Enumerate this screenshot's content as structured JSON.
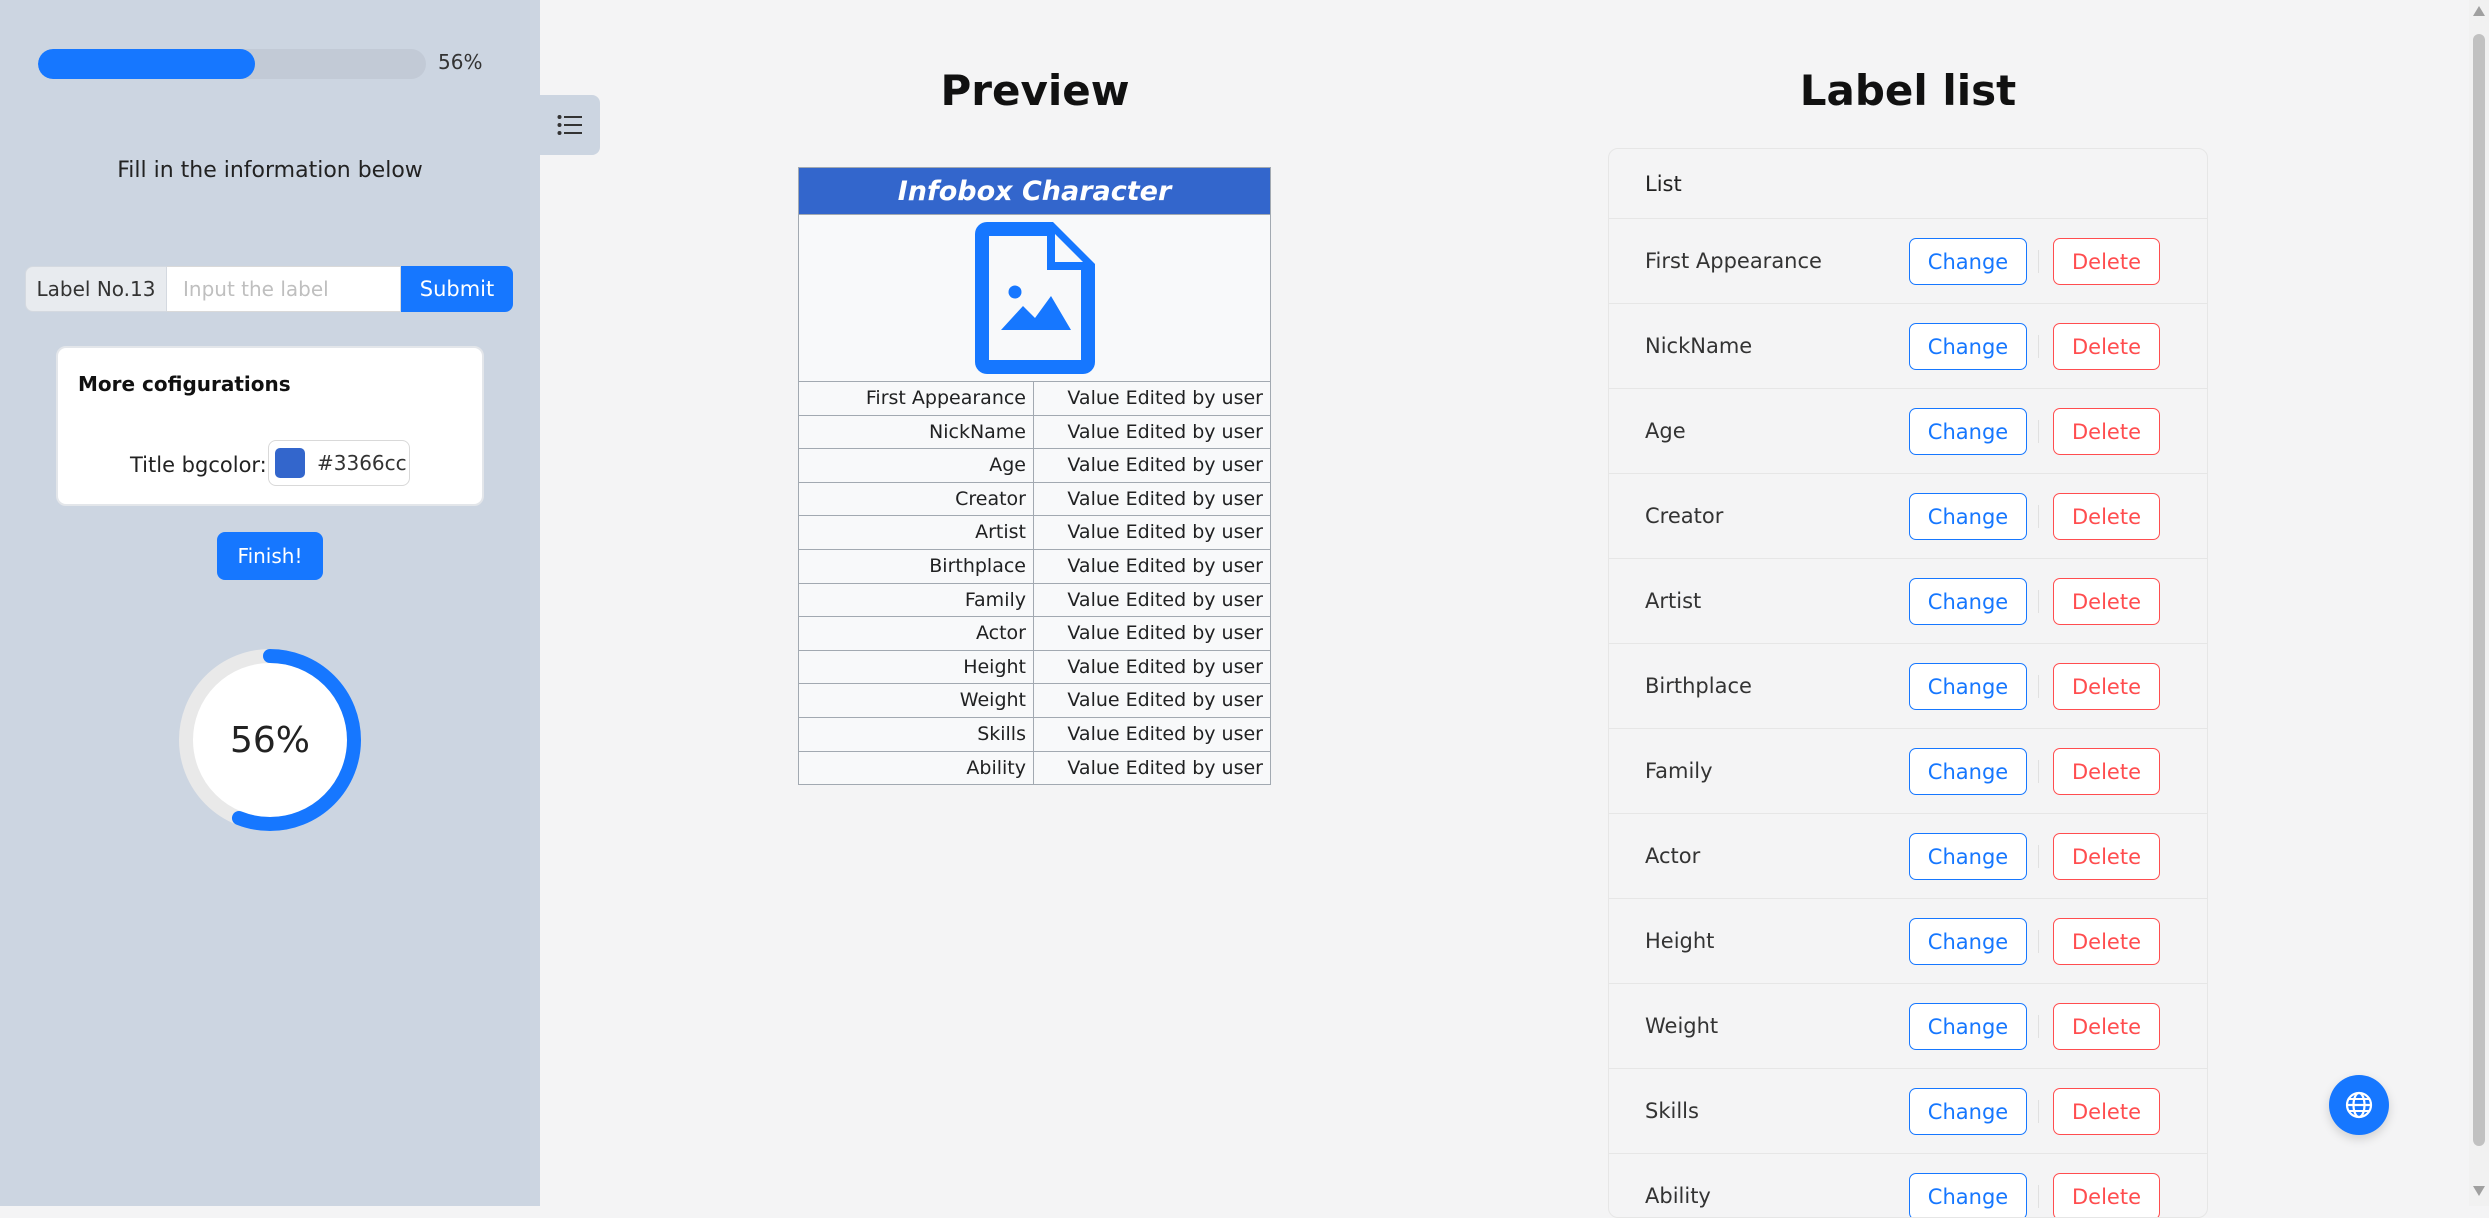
{
  "sidebar": {
    "progress": {
      "value": 56,
      "text": "56%"
    },
    "instruction": "Fill in the information below",
    "label_input": {
      "addon": "Label No.13",
      "placeholder": "Input the label",
      "value": "",
      "submit_label": "Submit"
    },
    "config": {
      "title": "More cofigurations",
      "bgcolor_label": "Title bgcolor:",
      "bgcolor_value": "#3366cc"
    },
    "finish_label": "Finish!",
    "circle": {
      "value": 56,
      "text": "56%"
    }
  },
  "preview": {
    "heading": "Preview",
    "infobox": {
      "title": "Infobox Character",
      "title_bgcolor": "#3366cc",
      "image_icon": "file-image-icon",
      "rows": [
        {
          "label": "First Appearance",
          "value": "Value Edited by user"
        },
        {
          "label": "NickName",
          "value": "Value Edited by user"
        },
        {
          "label": "Age",
          "value": "Value Edited by user"
        },
        {
          "label": "Creator",
          "value": "Value Edited by user"
        },
        {
          "label": "Artist",
          "value": "Value Edited by user"
        },
        {
          "label": "Birthplace",
          "value": "Value Edited by user"
        },
        {
          "label": "Family",
          "value": "Value Edited by user"
        },
        {
          "label": "Actor",
          "value": "Value Edited by user"
        },
        {
          "label": "Height",
          "value": "Value Edited by user"
        },
        {
          "label": "Weight",
          "value": "Value Edited by user"
        },
        {
          "label": "Skills",
          "value": "Value Edited by user"
        },
        {
          "label": "Ability",
          "value": "Value Edited by user"
        }
      ]
    }
  },
  "label_list": {
    "heading": "Label list",
    "header": "List",
    "change_label": "Change",
    "delete_label": "Delete",
    "items": [
      "First Appearance",
      "NickName",
      "Age",
      "Creator",
      "Artist",
      "Birthplace",
      "Family",
      "Actor",
      "Height",
      "Weight",
      "Skills",
      "Ability"
    ]
  },
  "icons": {
    "toggle": "list-icon",
    "float": "globe-icon"
  },
  "colors": {
    "primary": "#1677ff",
    "danger": "#ff4d4f",
    "sidebar_bg": "#ccd5e1",
    "main_bg": "#f4f4f5"
  }
}
